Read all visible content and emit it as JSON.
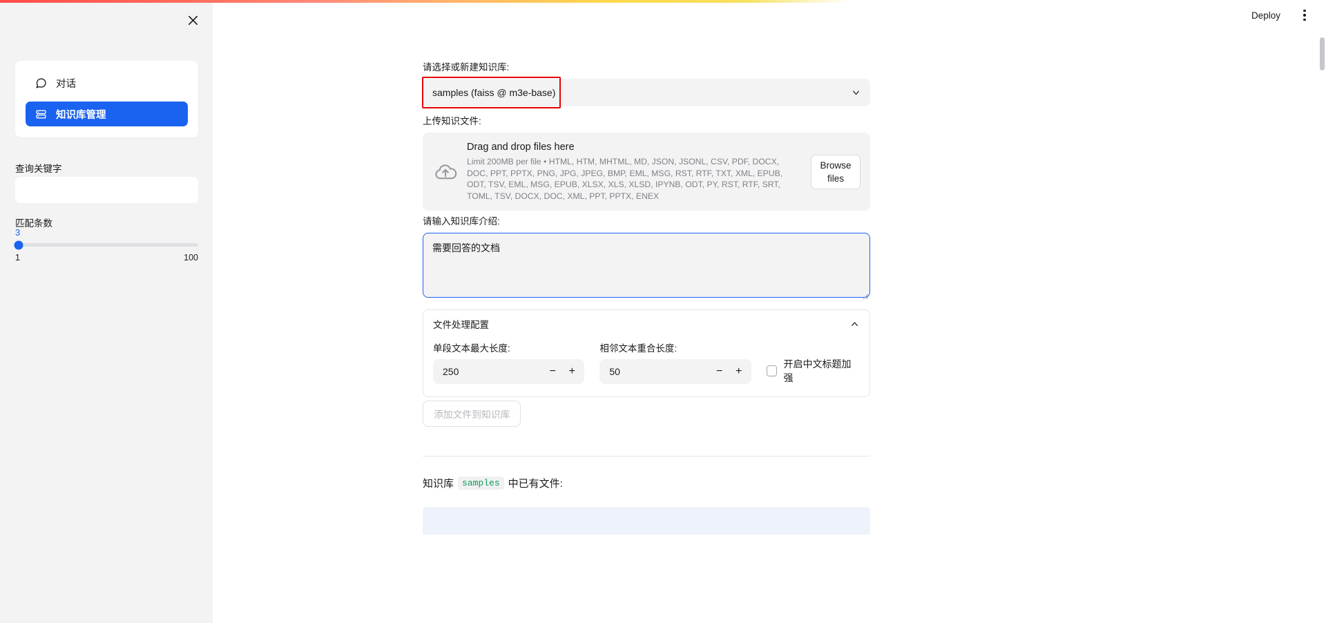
{
  "header": {
    "deploy_label": "Deploy",
    "menu_icon": "kebab-menu-icon"
  },
  "sidebar": {
    "close_icon": "close-icon",
    "nav_items": [
      {
        "label": "对话",
        "icon": "chat-bubble-icon",
        "active": false
      },
      {
        "label": "知识库管理",
        "icon": "list-rows-icon",
        "active": true
      }
    ],
    "keyword": {
      "label": "查询关键字",
      "value": "",
      "placeholder": ""
    },
    "match_count": {
      "label": "匹配条数",
      "value": "3",
      "min": "1",
      "max": "100"
    }
  },
  "main": {
    "kb_select": {
      "label": "请选择或新建知识库:",
      "value": "samples (faiss @ m3e-base)",
      "caret_icon": "chevron-down-icon",
      "highlight_color": "#e60000"
    },
    "uploader": {
      "label": "上传知识文件:",
      "icon": "cloud-upload-icon",
      "title": "Drag and drop files here",
      "limits": "Limit 200MB per file • HTML, HTM, MHTML, MD, JSON, JSONL, CSV, PDF, DOCX, DOC, PPT, PPTX, PNG, JPG, JPEG, BMP, EML, MSG, RST, RTF, TXT, XML, EPUB, ODT, TSV, EML, MSG, EPUB, XLSX, XLS, XLSD, IPYNB, ODT, PY, RST, RTF, SRT, TOML, TSV, DOCX, DOC, XML, PPT, PPTX, ENEX",
      "browse_label": "Browse files"
    },
    "intro": {
      "label": "请输入知识库介绍:",
      "value": "需要回答的文档",
      "placeholder": ""
    },
    "file_config": {
      "title": "文件处理配置",
      "chevron_icon": "chevron-up-icon",
      "chunk_size": {
        "label": "单段文本最大长度:",
        "value": "250",
        "minus_label": "−",
        "plus_label": "+"
      },
      "chunk_overlap": {
        "label": "相邻文本重合长度:",
        "value": "50",
        "minus_label": "−",
        "plus_label": "+"
      },
      "zh_title_enhance": {
        "label": "开启中文标题加强",
        "checked": false
      }
    },
    "add_files_button": "添加文件到知识库",
    "existing_files": {
      "prefix": "知识库",
      "kb_name": "samples",
      "suffix": "中已有文件:"
    }
  }
}
